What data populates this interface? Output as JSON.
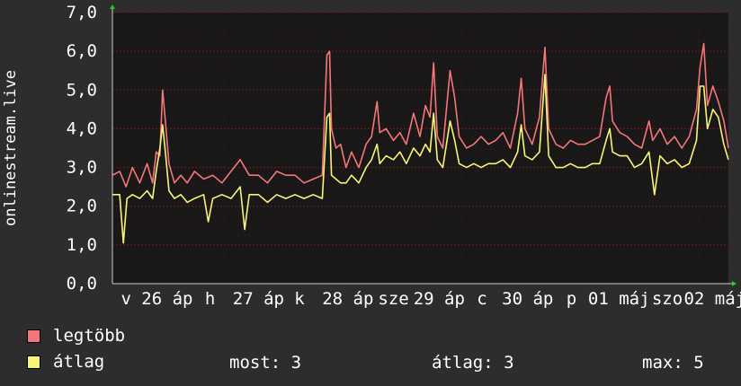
{
  "chart_data": {
    "type": "line",
    "ylabel": "onlinestream.live",
    "ylim": [
      0,
      7
    ],
    "yticks": [
      0,
      1,
      2,
      3,
      4,
      5,
      6,
      7
    ],
    "ytick_labels": [
      "0,0",
      "1,0",
      "2,0",
      "3,0",
      "4,0",
      "5,0",
      "6,0",
      "7,0"
    ],
    "xlim": [
      0,
      675
    ],
    "xtick_labels": [
      {
        "x": 15,
        "label": "v"
      },
      {
        "x": 60,
        "label": "26 áp"
      },
      {
        "x": 107,
        "label": "h"
      },
      {
        "x": 160,
        "label": "27 áp"
      },
      {
        "x": 205,
        "label": "k"
      },
      {
        "x": 258,
        "label": "28 áp"
      },
      {
        "x": 308,
        "label": "sze"
      },
      {
        "x": 358,
        "label": "29 áp"
      },
      {
        "x": 405,
        "label": "c"
      },
      {
        "x": 455,
        "label": "30 áp"
      },
      {
        "x": 503,
        "label": "p"
      },
      {
        "x": 555,
        "label": "01 máj"
      },
      {
        "x": 608,
        "label": "szo"
      },
      {
        "x": 660,
        "label": "02 máj"
      }
    ],
    "grid": true,
    "series": [
      {
        "name": "legtöbb",
        "color": "#f4767b",
        "points": [
          [
            0,
            2.8
          ],
          [
            8,
            2.9
          ],
          [
            15,
            2.5
          ],
          [
            22,
            3.0
          ],
          [
            30,
            2.6
          ],
          [
            38,
            3.1
          ],
          [
            44,
            2.6
          ],
          [
            48,
            3.4
          ],
          [
            52,
            3.3
          ],
          [
            55,
            5.0
          ],
          [
            58,
            4.2
          ],
          [
            62,
            3.1
          ],
          [
            68,
            2.6
          ],
          [
            75,
            2.8
          ],
          [
            82,
            2.6
          ],
          [
            90,
            2.9
          ],
          [
            100,
            2.7
          ],
          [
            110,
            2.8
          ],
          [
            120,
            2.6
          ],
          [
            130,
            2.9
          ],
          [
            140,
            3.2
          ],
          [
            150,
            2.8
          ],
          [
            160,
            2.8
          ],
          [
            170,
            2.6
          ],
          [
            180,
            2.9
          ],
          [
            190,
            2.8
          ],
          [
            200,
            2.8
          ],
          [
            210,
            2.6
          ],
          [
            220,
            2.7
          ],
          [
            230,
            2.8
          ],
          [
            235,
            5.9
          ],
          [
            238,
            6.0
          ],
          [
            240,
            4.0
          ],
          [
            245,
            3.5
          ],
          [
            250,
            3.6
          ],
          [
            256,
            3.0
          ],
          [
            262,
            3.4
          ],
          [
            270,
            3.0
          ],
          [
            278,
            3.6
          ],
          [
            284,
            3.8
          ],
          [
            290,
            4.7
          ],
          [
            293,
            3.9
          ],
          [
            300,
            4.0
          ],
          [
            308,
            3.7
          ],
          [
            315,
            3.9
          ],
          [
            322,
            3.6
          ],
          [
            330,
            4.4
          ],
          [
            337,
            3.8
          ],
          [
            343,
            4.6
          ],
          [
            348,
            4.3
          ],
          [
            352,
            5.7
          ],
          [
            356,
            3.8
          ],
          [
            362,
            3.5
          ],
          [
            370,
            5.5
          ],
          [
            375,
            4.8
          ],
          [
            380,
            3.8
          ],
          [
            388,
            3.5
          ],
          [
            396,
            3.6
          ],
          [
            404,
            3.8
          ],
          [
            412,
            3.6
          ],
          [
            420,
            3.7
          ],
          [
            428,
            3.9
          ],
          [
            436,
            3.5
          ],
          [
            444,
            4.4
          ],
          [
            448,
            5.3
          ],
          [
            452,
            4.0
          ],
          [
            460,
            3.6
          ],
          [
            468,
            4.3
          ],
          [
            474,
            6.1
          ],
          [
            478,
            4.0
          ],
          [
            486,
            3.6
          ],
          [
            494,
            3.5
          ],
          [
            502,
            3.7
          ],
          [
            510,
            3.6
          ],
          [
            518,
            3.6
          ],
          [
            526,
            3.7
          ],
          [
            534,
            3.8
          ],
          [
            541,
            4.8
          ],
          [
            545,
            5.1
          ],
          [
            548,
            4.2
          ],
          [
            556,
            3.9
          ],
          [
            564,
            3.8
          ],
          [
            572,
            3.6
          ],
          [
            580,
            3.5
          ],
          [
            588,
            4.2
          ],
          [
            592,
            3.7
          ],
          [
            600,
            4.0
          ],
          [
            608,
            3.6
          ],
          [
            616,
            3.8
          ],
          [
            624,
            3.5
          ],
          [
            632,
            3.8
          ],
          [
            640,
            4.5
          ],
          [
            644,
            5.6
          ],
          [
            648,
            6.2
          ],
          [
            652,
            4.6
          ],
          [
            658,
            5.1
          ],
          [
            664,
            4.7
          ],
          [
            670,
            4.2
          ],
          [
            675,
            3.5
          ]
        ]
      },
      {
        "name": "átlag",
        "color": "#f6f57a",
        "points": [
          [
            0,
            2.3
          ],
          [
            8,
            2.3
          ],
          [
            12,
            1.05
          ],
          [
            16,
            2.2
          ],
          [
            22,
            2.3
          ],
          [
            30,
            2.2
          ],
          [
            38,
            2.4
          ],
          [
            44,
            2.2
          ],
          [
            48,
            2.9
          ],
          [
            52,
            3.5
          ],
          [
            55,
            4.1
          ],
          [
            58,
            3.4
          ],
          [
            62,
            2.4
          ],
          [
            68,
            2.2
          ],
          [
            75,
            2.3
          ],
          [
            82,
            2.1
          ],
          [
            90,
            2.2
          ],
          [
            100,
            2.3
          ],
          [
            105,
            1.6
          ],
          [
            110,
            2.2
          ],
          [
            120,
            2.3
          ],
          [
            130,
            2.2
          ],
          [
            140,
            2.5
          ],
          [
            145,
            1.4
          ],
          [
            150,
            2.3
          ],
          [
            160,
            2.3
          ],
          [
            170,
            2.1
          ],
          [
            180,
            2.3
          ],
          [
            190,
            2.2
          ],
          [
            200,
            2.3
          ],
          [
            210,
            2.2
          ],
          [
            220,
            2.3
          ],
          [
            230,
            2.2
          ],
          [
            235,
            4.3
          ],
          [
            238,
            4.4
          ],
          [
            240,
            2.8
          ],
          [
            245,
            2.7
          ],
          [
            250,
            2.6
          ],
          [
            256,
            2.6
          ],
          [
            262,
            2.8
          ],
          [
            270,
            2.6
          ],
          [
            278,
            3.0
          ],
          [
            284,
            3.2
          ],
          [
            290,
            3.6
          ],
          [
            293,
            3.1
          ],
          [
            300,
            3.3
          ],
          [
            308,
            3.2
          ],
          [
            315,
            3.4
          ],
          [
            322,
            3.1
          ],
          [
            330,
            3.5
          ],
          [
            337,
            3.3
          ],
          [
            343,
            3.6
          ],
          [
            348,
            3.4
          ],
          [
            352,
            4.4
          ],
          [
            356,
            3.2
          ],
          [
            362,
            3.0
          ],
          [
            370,
            4.2
          ],
          [
            375,
            3.7
          ],
          [
            380,
            3.1
          ],
          [
            388,
            3.0
          ],
          [
            396,
            3.1
          ],
          [
            404,
            3.0
          ],
          [
            412,
            3.1
          ],
          [
            420,
            3.1
          ],
          [
            428,
            3.2
          ],
          [
            436,
            3.0
          ],
          [
            444,
            3.4
          ],
          [
            448,
            4.1
          ],
          [
            452,
            3.3
          ],
          [
            460,
            3.2
          ],
          [
            468,
            3.4
          ],
          [
            474,
            5.4
          ],
          [
            478,
            3.3
          ],
          [
            486,
            3.0
          ],
          [
            494,
            3.0
          ],
          [
            502,
            3.1
          ],
          [
            510,
            3.0
          ],
          [
            518,
            3.0
          ],
          [
            526,
            3.1
          ],
          [
            534,
            3.1
          ],
          [
            541,
            3.7
          ],
          [
            545,
            4.0
          ],
          [
            548,
            3.4
          ],
          [
            556,
            3.3
          ],
          [
            564,
            3.3
          ],
          [
            572,
            3.0
          ],
          [
            580,
            3.1
          ],
          [
            588,
            3.4
          ],
          [
            594,
            2.3
          ],
          [
            600,
            3.3
          ],
          [
            608,
            3.1
          ],
          [
            616,
            3.2
          ],
          [
            624,
            3.0
          ],
          [
            632,
            3.1
          ],
          [
            640,
            3.7
          ],
          [
            644,
            5.1
          ],
          [
            648,
            5.1
          ],
          [
            652,
            4.0
          ],
          [
            658,
            4.5
          ],
          [
            664,
            4.3
          ],
          [
            670,
            3.6
          ],
          [
            675,
            3.2
          ]
        ]
      }
    ]
  },
  "legend": [
    {
      "label": "legtöbb",
      "color": "#f4767b"
    },
    {
      "label": "átlag",
      "color": "#f6f57a"
    }
  ],
  "stats": {
    "most": "most: 3",
    "atlag": "átlag: 3",
    "max": "max: 5"
  },
  "colors": {
    "background": "#2d2d2d",
    "plot_bg": "#181818",
    "grid": "#7a1515",
    "text": "#ffffff",
    "arrow": "#22cc22"
  }
}
